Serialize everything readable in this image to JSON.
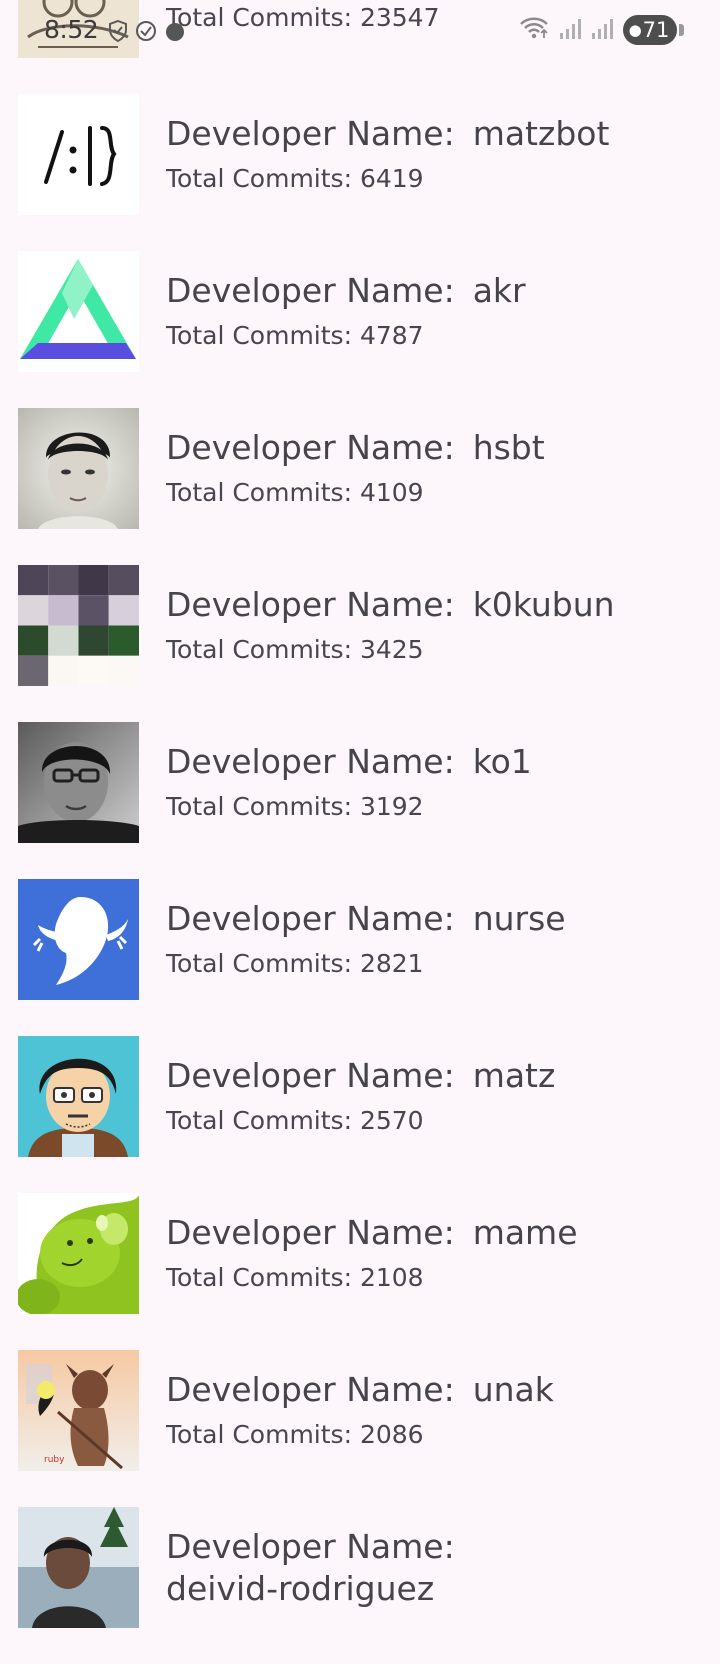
{
  "status_bar": {
    "time": "8:52",
    "battery_level": "71",
    "icons": [
      "vpn-shield-icon",
      "check-circle-icon",
      "notification-dot-icon",
      "wifi-icon",
      "signal-icon",
      "signal-icon",
      "battery-icon"
    ]
  },
  "list": {
    "name_label": "Developer Name:",
    "commits_label": "Total Commits:",
    "top_partial": {
      "commits": "23547"
    },
    "developers": [
      {
        "name": "matzbot",
        "commits": "6419",
        "avatar": "matzbot-avatar"
      },
      {
        "name": "akr",
        "commits": "4787",
        "avatar": "akr-avatar"
      },
      {
        "name": "hsbt",
        "commits": "4109",
        "avatar": "hsbt-avatar"
      },
      {
        "name": "k0kubun",
        "commits": "3425",
        "avatar": "k0kubun-avatar"
      },
      {
        "name": "ko1",
        "commits": "3192",
        "avatar": "ko1-avatar"
      },
      {
        "name": "nurse",
        "commits": "2821",
        "avatar": "nurse-avatar"
      },
      {
        "name": "matz",
        "commits": "2570",
        "avatar": "matz-avatar"
      },
      {
        "name": "mame",
        "commits": "2108",
        "avatar": "mame-avatar"
      },
      {
        "name": "unak",
        "commits": "2086",
        "avatar": "unak-avatar"
      }
    ],
    "bottom_partial": {
      "name": "deivid-rodriguez"
    }
  },
  "colors": {
    "background": "#fdf7fc",
    "text_primary": "#46434b",
    "text_secondary": "#49454e"
  }
}
